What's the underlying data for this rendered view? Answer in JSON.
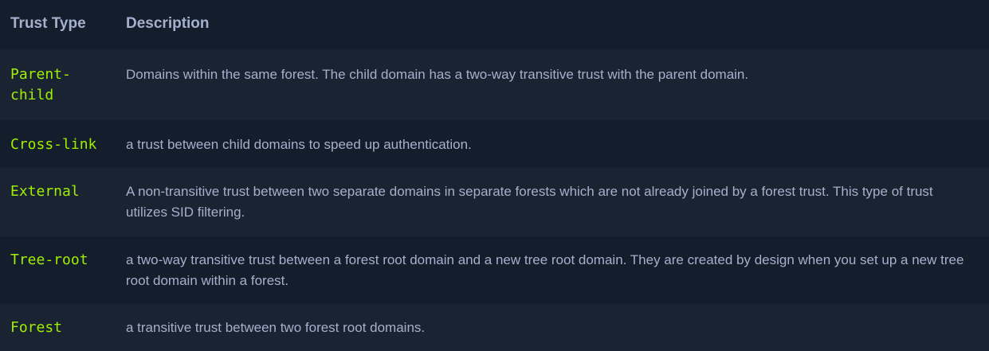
{
  "table": {
    "headers": {
      "type": "Trust Type",
      "description": "Description"
    },
    "rows": [
      {
        "type_lines": [
          "Parent-",
          "child"
        ],
        "desc_lines": [
          "Domains within the same forest. The child domain has a two-way transitive trust with the parent domain."
        ]
      },
      {
        "type_lines": [
          "Cross-link"
        ],
        "desc_lines": [
          "a trust between child domains to speed up authentication."
        ]
      },
      {
        "type_lines": [
          "External"
        ],
        "desc_lines": [
          "A non-transitive trust between two separate domains in separate forests which are not already joined by a forest trust. This type of trust",
          "utilizes SID filtering."
        ]
      },
      {
        "type_lines": [
          "Tree-root"
        ],
        "desc_lines": [
          "a two-way transitive trust between a forest root domain and a new tree root domain. They are created by design when you set up a new tree",
          "root domain within a forest."
        ]
      },
      {
        "type_lines": [
          "Forest"
        ],
        "desc_lines": [
          "a transitive trust between two forest root domains."
        ]
      }
    ]
  },
  "colors": {
    "background": "#141d2b",
    "row_alt": "#1a2332",
    "header_text": "#a4b1cd",
    "code_text": "#9fef00",
    "body_text": "#a4b1cd"
  }
}
